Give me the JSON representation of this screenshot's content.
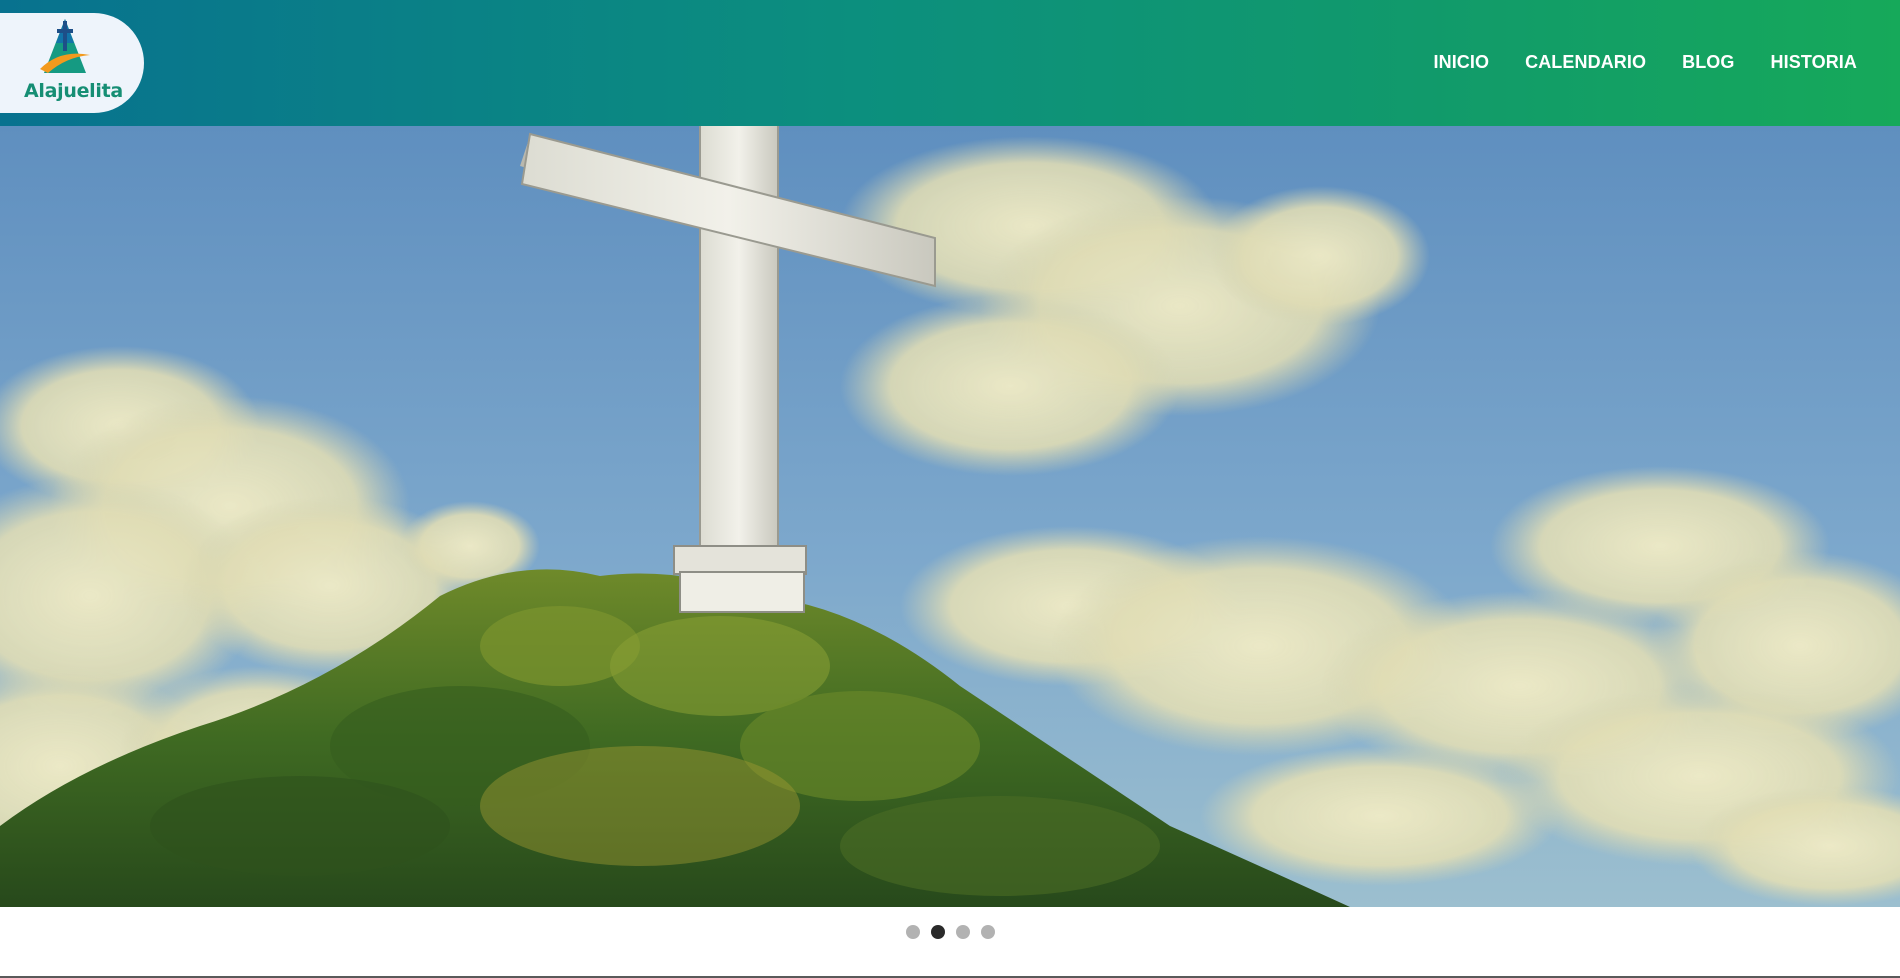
{
  "header": {
    "logo": {
      "text": "Alajuelita",
      "icon": "alajuelita-cross-logo-icon"
    },
    "nav": [
      {
        "label": "INICIO"
      },
      {
        "label": "CALENDARIO"
      },
      {
        "label": "BLOG"
      },
      {
        "label": "HISTORIA"
      }
    ]
  },
  "hero": {
    "image": "painting-white-cross-on-forested-hill-under-cloudy-sky",
    "carousel": {
      "slide_count": 4,
      "active_slide": 2
    }
  },
  "colors": {
    "header_gradient_start": "#08728f",
    "header_gradient_end": "#16a95a",
    "logo_green": "#168e74",
    "dot_active": "#2a2a2a",
    "dot_inactive": "#b2b2b2"
  }
}
